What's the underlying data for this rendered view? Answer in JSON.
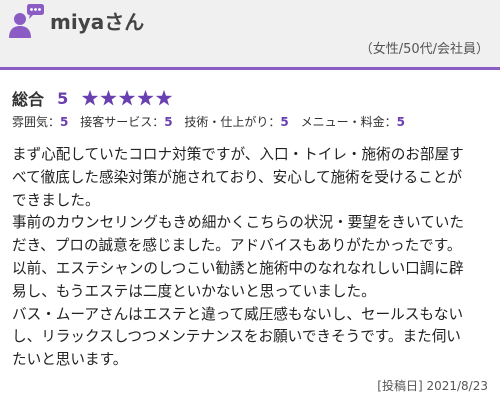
{
  "reviewer": {
    "name": "miyaさん",
    "profile": "（女性/50代/会社員）",
    "avatar_icon": "user-comment-icon"
  },
  "rating": {
    "label": "総合",
    "score": "5",
    "stars_filled": 5,
    "stars_total": 5,
    "accent_color": "#6a3fb0"
  },
  "sub_ratings": [
    {
      "label": "雰囲気：",
      "value": "5"
    },
    {
      "label": "接客サービス：",
      "value": "5"
    },
    {
      "label": "技術・仕上がり：",
      "value": "5"
    },
    {
      "label": "メニュー・料金：",
      "value": "5"
    }
  ],
  "review_lines": [
    "まず心配していたコロナ対策ですが、入口・トイレ・施術のお部屋す",
    "べて徹底した感染対策が施されており、安心して施術を受けることが",
    "できました。",
    "事前のカウンセリングもきめ細かくこちらの状況・要望をきいていた",
    "だき、プロの誠意を感じました。アドバイスもありがたかったです。",
    "以前、エステシャンのしつこい勧誘と施術中のなれなれしい口調に辟",
    "易し、もうエステは二度といかないと思っていました。",
    "バス・ムーアさんはエステと違って威圧感もないし、セールスもない",
    "し、リラックスしつつメンテナンスをお願いできそうです。また伺い",
    "たいと思います。"
  ],
  "posted": "[投稿日] 2021/8/23"
}
